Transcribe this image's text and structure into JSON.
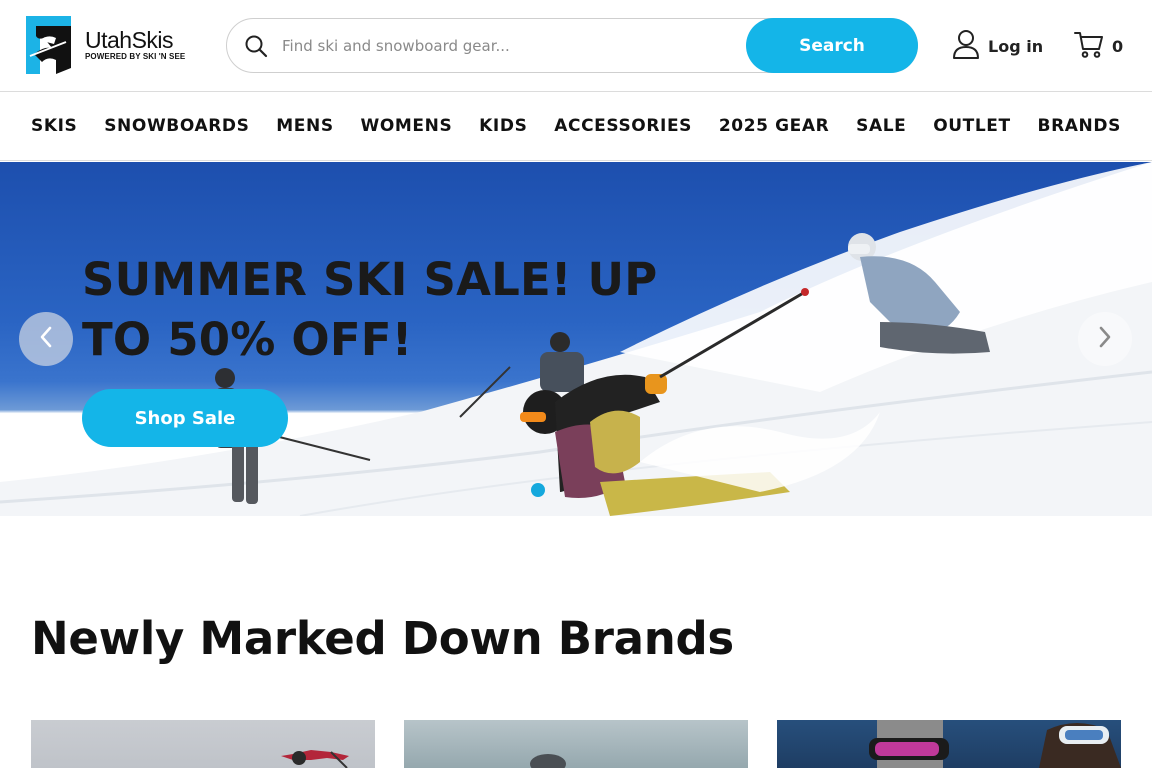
{
  "header": {
    "logo": {
      "name": "UtahSkis",
      "tagline": "POWERED BY SKI 'N SEE"
    },
    "search": {
      "placeholder": "Find ski and snowboard gear...",
      "value": "",
      "button_label": "Search"
    },
    "login_label": "Log in",
    "cart_count": "0"
  },
  "nav": {
    "items": [
      "SKIS",
      "SNOWBOARDS",
      "MENS",
      "WOMENS",
      "KIDS",
      "ACCESSORIES",
      "2025 GEAR",
      "SALE",
      "OUTLET",
      "BRANDS"
    ]
  },
  "hero": {
    "title": "SUMMER SKI SALE! UP TO 50% OFF!",
    "cta_label": "Shop Sale",
    "slide_count": 1,
    "active_slide": 1
  },
  "section": {
    "title": "Newly Marked Down Brands"
  },
  "icons": {
    "search": "search-icon",
    "user": "user-icon",
    "cart": "cart-icon",
    "prev": "chevron-left-icon",
    "next": "chevron-right-icon"
  },
  "colors": {
    "accent": "#14b5e8",
    "text": "#111111",
    "border": "#dcdcdc"
  }
}
